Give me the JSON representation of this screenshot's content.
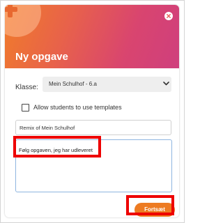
{
  "dialog": {
    "title": "Ny opgave",
    "close_icon": "close-circle-icon",
    "add_icon": "plus-icon"
  },
  "form": {
    "class_label": "Klasse:",
    "class_selected": "Mein Schulhof - 6.a",
    "templates_checkbox_label": "Allow students to use templates",
    "templates_checked": false,
    "name_value": "Remix of Mein Schulhof",
    "description_value": "Følg opgaven, jeg har udleveret"
  },
  "actions": {
    "submit_label": "Fortsæt"
  },
  "colors": {
    "header_gradient_start": "#f07c2a",
    "header_gradient_end": "#cf3f7d",
    "accent_button": "#ed7b22",
    "highlight_box": "#ee0000",
    "textarea_focus_border": "#8eb5e0"
  }
}
